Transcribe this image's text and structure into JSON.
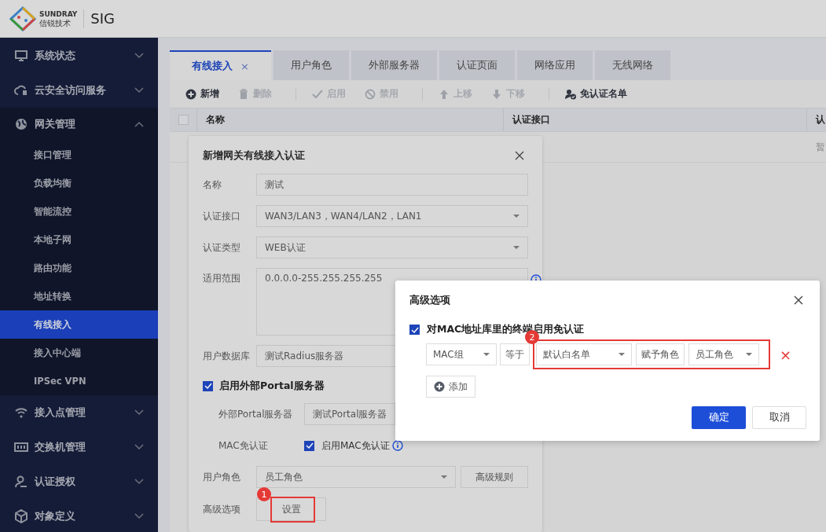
{
  "header": {
    "brand_en": "SUNDRAY",
    "brand_cn": "信锐技术",
    "product": "SIG"
  },
  "sidebar": {
    "groups": [
      {
        "label": "系统状态",
        "expanded": false
      },
      {
        "label": "云安全访问服务",
        "expanded": false
      },
      {
        "label": "网关管理",
        "expanded": true,
        "children": [
          {
            "label": "接口管理",
            "selected": false
          },
          {
            "label": "负载均衡",
            "selected": false
          },
          {
            "label": "智能流控",
            "selected": false
          },
          {
            "label": "本地子网",
            "selected": false
          },
          {
            "label": "路由功能",
            "selected": false
          },
          {
            "label": "地址转换",
            "selected": false
          },
          {
            "label": "有线接入",
            "selected": true
          },
          {
            "label": "接入中心端",
            "selected": false
          },
          {
            "label": "IPSec VPN",
            "selected": false
          }
        ]
      },
      {
        "label": "接入点管理",
        "expanded": false
      },
      {
        "label": "交换机管理",
        "expanded": false
      },
      {
        "label": "认证授权",
        "expanded": false
      },
      {
        "label": "对象定义",
        "expanded": false
      }
    ]
  },
  "tabs": [
    {
      "label": "有线接入",
      "selected": true,
      "closable": true,
      "close": "×"
    },
    {
      "label": "用户角色",
      "selected": false,
      "closable": false
    },
    {
      "label": "外部服务器",
      "selected": false,
      "closable": false
    },
    {
      "label": "认证页面",
      "selected": false,
      "closable": false
    },
    {
      "label": "网络应用",
      "selected": false,
      "closable": false
    },
    {
      "label": "无线网络",
      "selected": false,
      "closable": false
    }
  ],
  "toolbar": {
    "groups": [
      [
        {
          "label": "新增",
          "disabled": false
        },
        {
          "label": "删除",
          "disabled": true
        }
      ],
      [
        {
          "label": "启用",
          "disabled": true
        },
        {
          "label": "禁用",
          "disabled": true
        }
      ],
      [
        {
          "label": "上移",
          "disabled": true
        },
        {
          "label": "下移",
          "disabled": true
        }
      ],
      [
        {
          "label": "免认证名单",
          "disabled": false
        }
      ]
    ]
  },
  "table": {
    "select_all": {
      "checked": false
    },
    "columns": [
      "名称",
      "认证接口",
      "认"
    ],
    "empty_text": "暂"
  },
  "dialog": {
    "title": "新增网关有线接入认证",
    "rows": [
      {
        "kind": "input",
        "label": "名称",
        "value": "测试"
      },
      {
        "kind": "select",
        "label": "认证接口",
        "value": "WAN3/LAN3，WAN4/LAN2，LAN1"
      },
      {
        "kind": "select",
        "label": "认证类型",
        "value": "WEB认证"
      },
      {
        "kind": "textarea",
        "label": "适用范围",
        "value": "0.0.0.0-255.255.255.255"
      },
      {
        "kind": "input",
        "label": "用户数据库",
        "value": "测试Radius服务器"
      },
      {
        "kind": "checkbox",
        "label": "启用外部Portal服务器",
        "checked": true,
        "children": [
          {
            "kind": "input",
            "label": "外部Portal服务器",
            "value": "测试Portal服务器"
          },
          {
            "kind": "check",
            "label": "MAC免认证",
            "text": "启用MAC免认证",
            "checked": true
          }
        ]
      },
      {
        "kind": "selectbutton",
        "label": "用户角色",
        "value": "员工角色",
        "button": "高级规则"
      },
      {
        "kind": "button",
        "label": "高级选项",
        "button": "设置",
        "step": "1"
      }
    ]
  },
  "advanced": {
    "title": "高级选项",
    "option": {
      "label": "对MAC地址库里的终端启用免认证",
      "checked": true
    },
    "rule": {
      "field": "MAC组",
      "operator": "等于",
      "group": "默认白名单",
      "assign": "赋予角色",
      "role": "员工角色",
      "remove": "×",
      "step": "2"
    },
    "add": "添加",
    "ok": "确定",
    "cancel": "取消"
  }
}
